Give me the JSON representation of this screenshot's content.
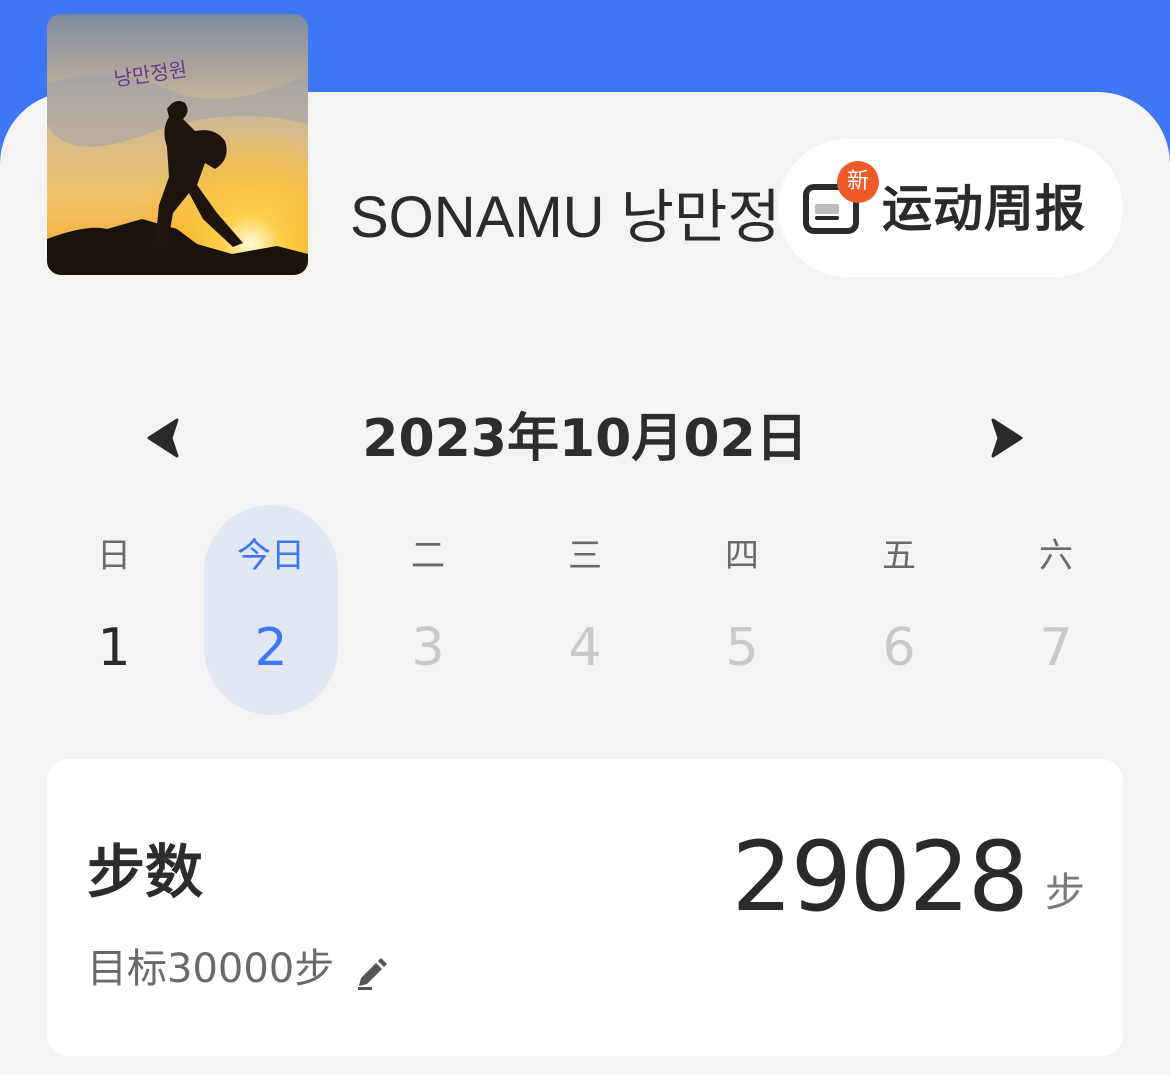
{
  "profile": {
    "name": "SONAMU 낭만정",
    "avatar_text": "낭만정원"
  },
  "weekly_report": {
    "badge": "新",
    "label": "运动周报",
    "icon": "report-icon"
  },
  "date_nav": {
    "title": "2023年10月02日",
    "prev_icon": "triangle-left-icon",
    "next_icon": "triangle-right-icon"
  },
  "week": {
    "days": [
      {
        "weekday": "日",
        "day": "1",
        "state": "past"
      },
      {
        "weekday": "今日",
        "day": "2",
        "state": "today"
      },
      {
        "weekday": "二",
        "day": "3",
        "state": "future"
      },
      {
        "weekday": "三",
        "day": "4",
        "state": "future"
      },
      {
        "weekday": "四",
        "day": "5",
        "state": "future"
      },
      {
        "weekday": "五",
        "day": "6",
        "state": "future"
      },
      {
        "weekday": "六",
        "day": "7",
        "state": "future"
      }
    ]
  },
  "steps": {
    "title": "步数",
    "value": "29028",
    "unit": "步",
    "goal": "目标30000步",
    "edit_icon": "pencil-icon"
  },
  "colors": {
    "header_blue": "#3d77f5",
    "today_bg": "#e2e8f3",
    "badge_orange": "#ef5a2b",
    "sheet_bg": "#f4f4f4"
  }
}
